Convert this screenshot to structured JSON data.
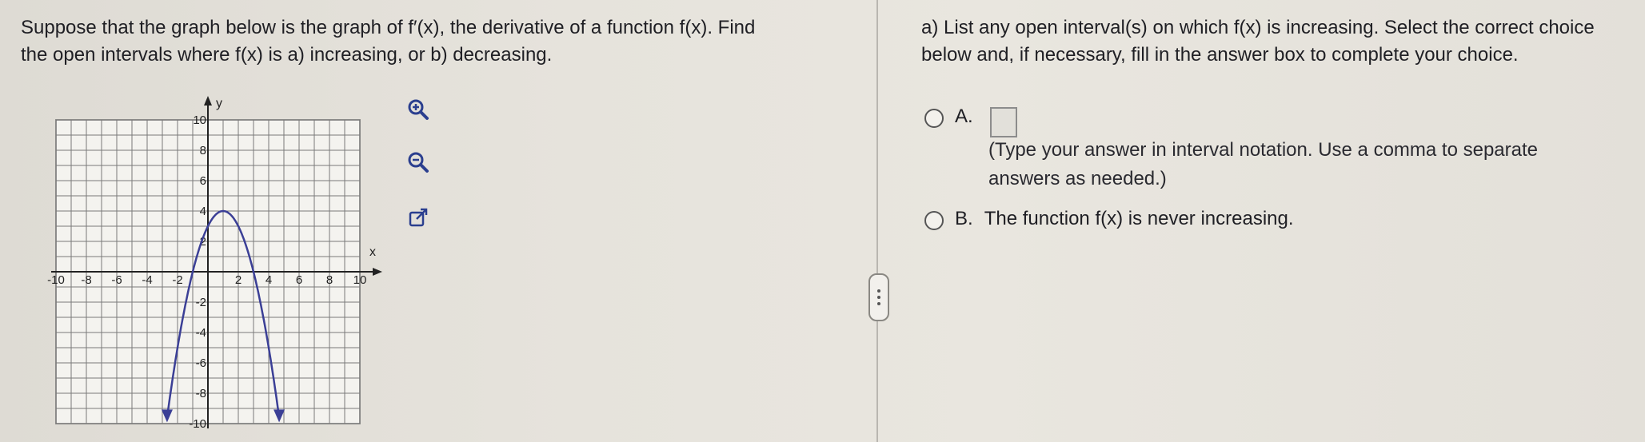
{
  "prompt": {
    "line1": "Suppose that the graph below is the graph of f′(x), the derivative of a function f(x). Find",
    "line2": "the open intervals where f(x) is a) increasing, or b) decreasing."
  },
  "graph": {
    "x_label": "x",
    "y_label": "y",
    "x_ticks": [
      "-10",
      "-8",
      "-6",
      "-4",
      "-2",
      "2",
      "4",
      "6",
      "8",
      "10"
    ],
    "y_ticks": [
      "10",
      "8",
      "6",
      "4",
      "2",
      "-2",
      "-4",
      "-6",
      "-8",
      "-10"
    ],
    "x_range": [
      -10,
      10
    ],
    "y_range": [
      -10,
      10
    ],
    "curve": {
      "type": "parabola",
      "vertex": [
        1,
        4
      ],
      "roots": [
        -1,
        3
      ]
    },
    "curve_color": "#3b3f96"
  },
  "tools": {
    "zoom_in": "zoom-in-icon",
    "zoom_out": "zoom-out-icon",
    "popout": "external-link-icon"
  },
  "question": {
    "line1": "a) List any open interval(s) on which f(x) is increasing. Select the correct choice",
    "line2": "below and, if necessary, fill in the answer box to complete your choice."
  },
  "choices": {
    "a_label": "A.",
    "a_hint_line1": "(Type your answer in interval notation. Use a comma to separate",
    "a_hint_line2": "answers as needed.)",
    "b_label": "B.",
    "b_text": "The function f(x) is never increasing."
  }
}
